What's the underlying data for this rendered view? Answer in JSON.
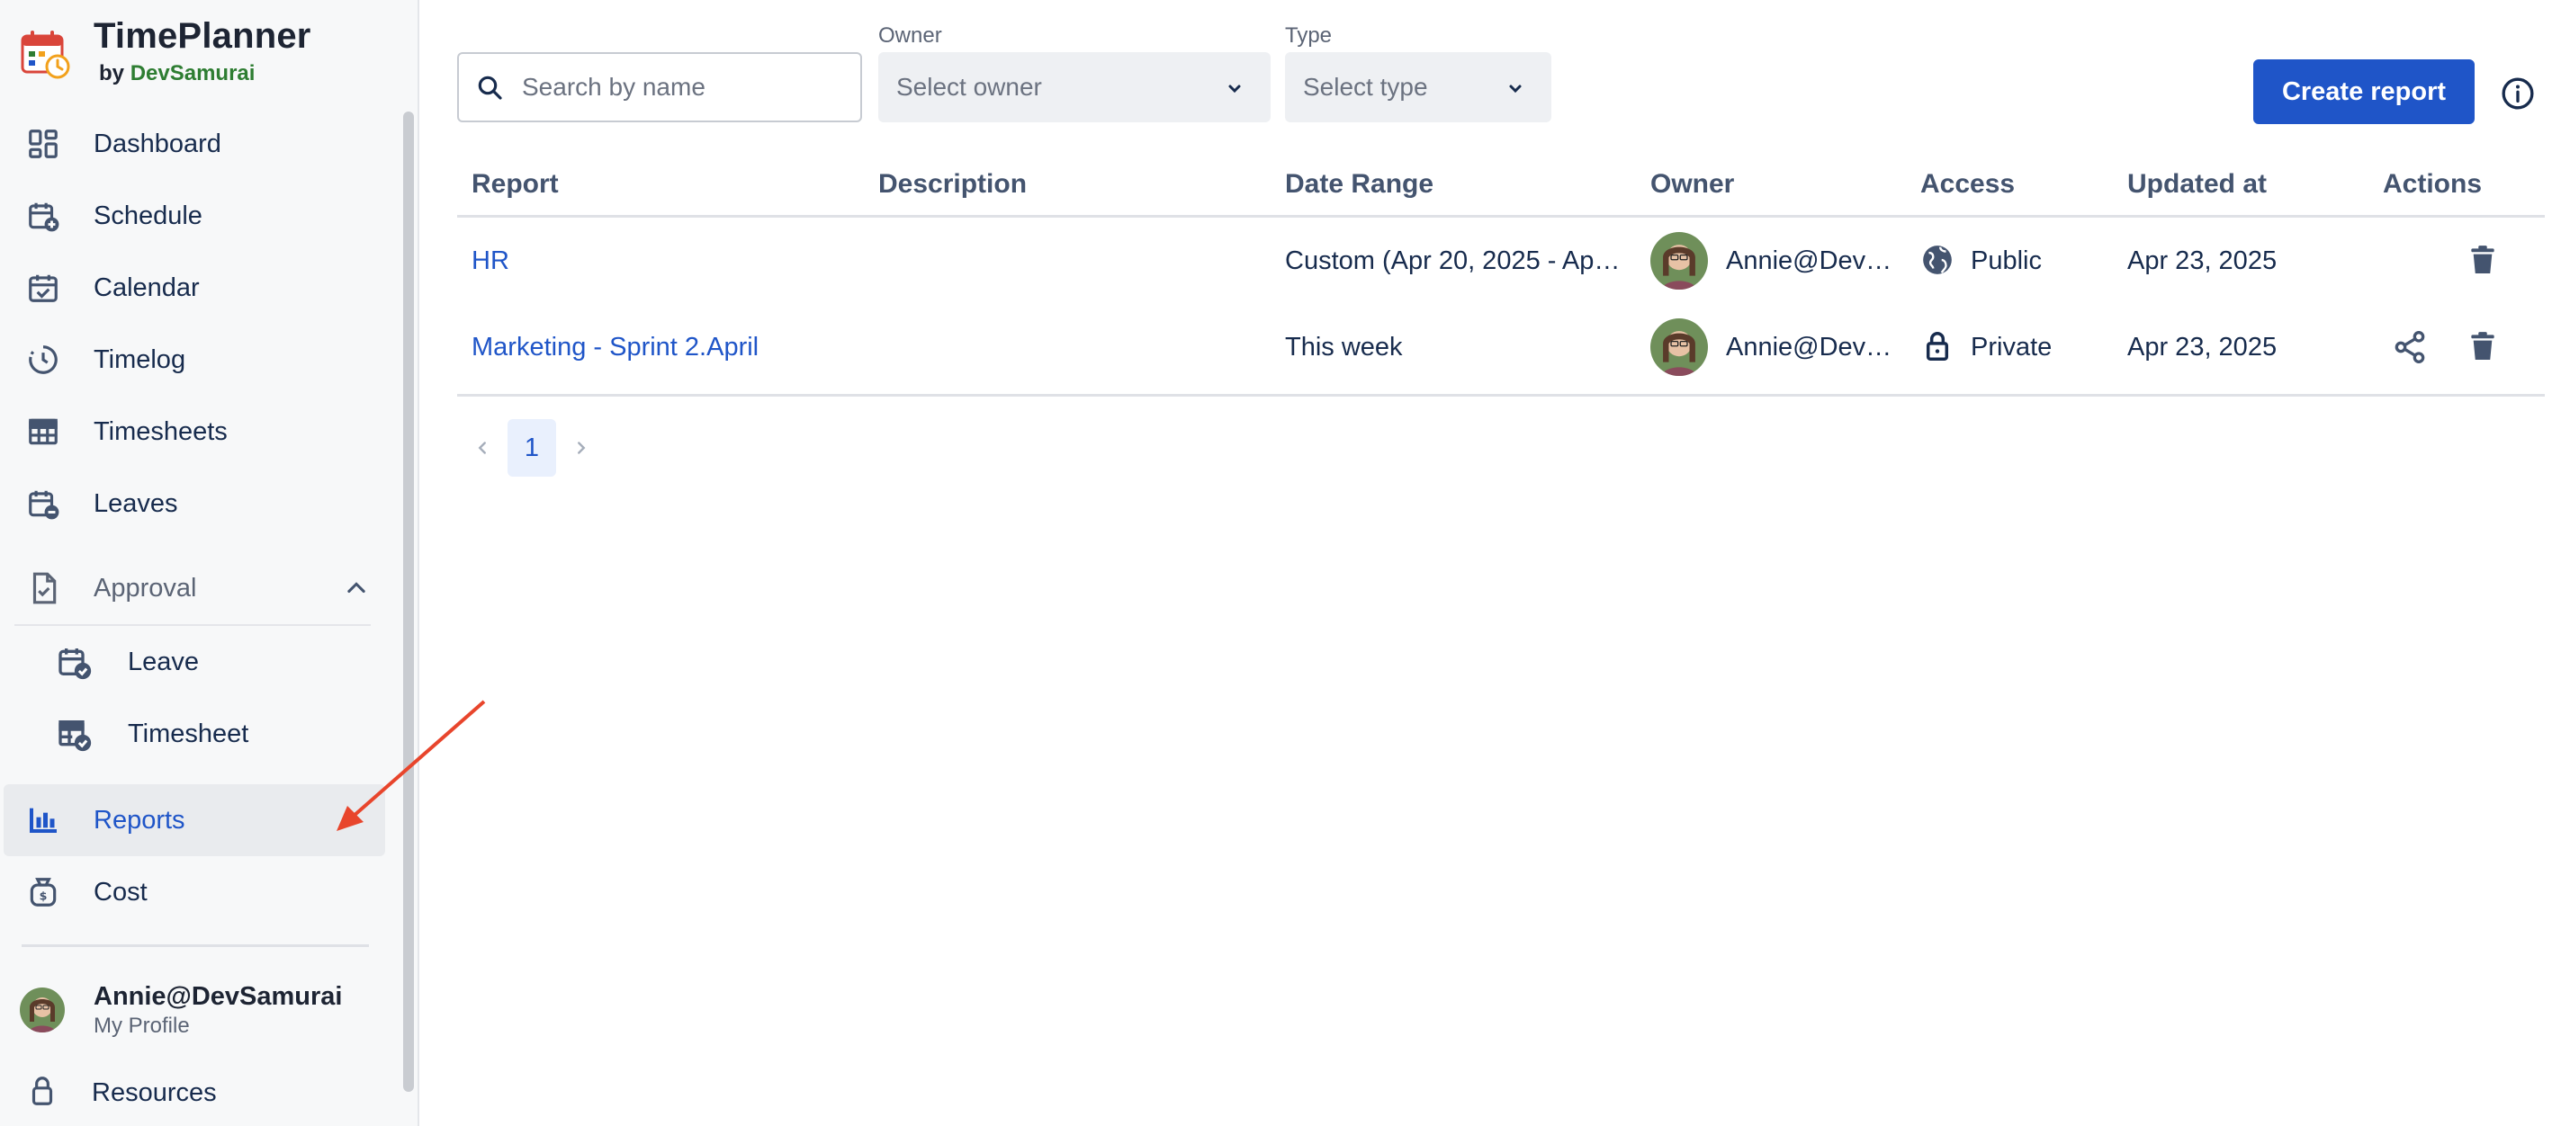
{
  "brand": {
    "title": "TimePlanner",
    "by": "by",
    "by_name": "DevSamurai"
  },
  "sidebar": {
    "items": [
      {
        "label": "Dashboard",
        "icon": "dashboard-icon"
      },
      {
        "label": "Schedule",
        "icon": "calendar-plus-icon"
      },
      {
        "label": "Calendar",
        "icon": "calendar-check-icon"
      },
      {
        "label": "Timelog",
        "icon": "clock-icon"
      },
      {
        "label": "Timesheets",
        "icon": "grid-icon"
      },
      {
        "label": "Leaves",
        "icon": "calendar-minus-icon"
      }
    ],
    "approval": {
      "label": "Approval",
      "icon": "file-check-icon",
      "children": [
        {
          "label": "Leave",
          "icon": "calendar-approve-icon"
        },
        {
          "label": "Timesheet",
          "icon": "grid-approve-icon"
        }
      ]
    },
    "reports": {
      "label": "Reports",
      "icon": "bar-chart-icon"
    },
    "cost": {
      "label": "Cost",
      "icon": "money-bag-icon"
    },
    "profile": {
      "name": "Annie@DevSamurai",
      "sub": "My Profile"
    },
    "resources": {
      "label": "Resources",
      "icon": "lock-icon"
    }
  },
  "toolbar": {
    "search_placeholder": "Search by name",
    "owner_label": "Owner",
    "owner_placeholder": "Select owner",
    "type_label": "Type",
    "type_placeholder": "Select type",
    "create_label": "Create report"
  },
  "table": {
    "headers": {
      "report": "Report",
      "description": "Description",
      "date_range": "Date Range",
      "owner": "Owner",
      "access": "Access",
      "updated_at": "Updated at",
      "actions": "Actions"
    },
    "rows": [
      {
        "report": "HR",
        "description": "",
        "date_range": "Custom (Apr 20, 2025 - Ap…",
        "owner": "Annie@Dev…",
        "access": "Public",
        "updated_at": "Apr 23, 2025",
        "shareable": false
      },
      {
        "report": "Marketing - Sprint 2.April",
        "description": "",
        "date_range": "This week",
        "owner": "Annie@Dev…",
        "access": "Private",
        "updated_at": "Apr 23, 2025",
        "shareable": true
      }
    ]
  },
  "pagination": {
    "current": "1"
  },
  "colors": {
    "accent": "#1f55c8",
    "annotation_arrow": "#e8452c"
  }
}
